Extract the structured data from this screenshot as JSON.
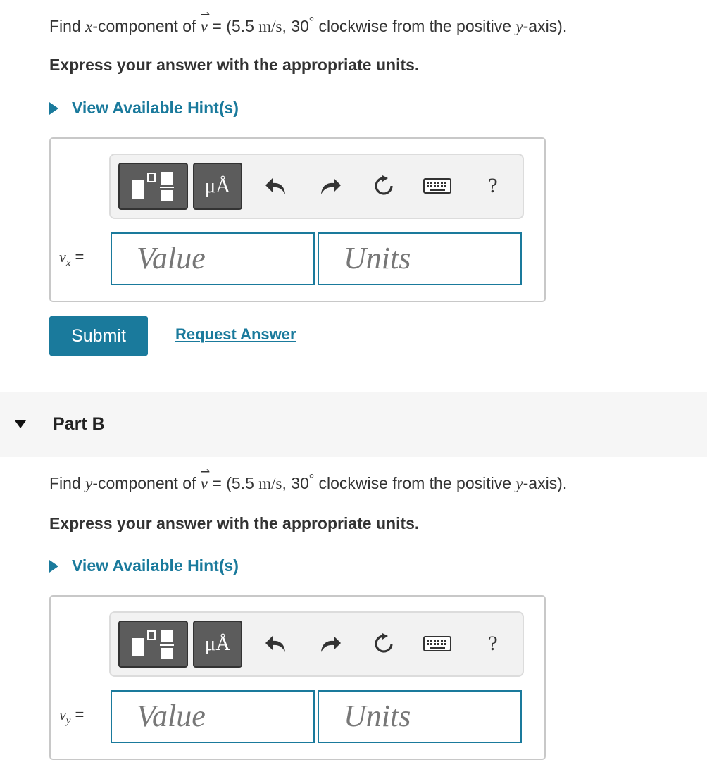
{
  "partA": {
    "question_prefix": "Find ",
    "question_var": "x",
    "question_mid": "-component of ",
    "vec": "v",
    "equals": " = ",
    "open": "(",
    "magnitude": "5.5",
    "unit_m": "m",
    "slash": "/",
    "unit_s": "s",
    "comma": ", ",
    "angle": "30",
    "degree": "°",
    "direction": " clockwise from the positive ",
    "axis_var": "y",
    "axis_suffix": "-axis).",
    "express": "Express your answer with the appropriate units.",
    "hint": "View Available Hint(s)",
    "var_letter": "v",
    "var_sub": "x",
    "var_eq": " =",
    "value_placeholder": "Value",
    "units_placeholder": "Units",
    "toolbar_units_label": "μÅ",
    "toolbar_help": "?",
    "submit": "Submit",
    "request": "Request Answer"
  },
  "partB": {
    "header": "Part B",
    "question_prefix": "Find ",
    "question_var": "y",
    "question_mid": "-component of ",
    "vec": "v",
    "equals": " = ",
    "open": "(",
    "magnitude": "5.5",
    "unit_m": "m",
    "slash": "/",
    "unit_s": "s",
    "comma": ", ",
    "angle": "30",
    "degree": "°",
    "direction": " clockwise from the positive ",
    "axis_var": "y",
    "axis_suffix": "-axis).",
    "express": "Express your answer with the appropriate units.",
    "hint": "View Available Hint(s)",
    "var_letter": "v",
    "var_sub": "y",
    "var_eq": " =",
    "value_placeholder": "Value",
    "units_placeholder": "Units",
    "toolbar_units_label": "μÅ",
    "toolbar_help": "?"
  },
  "icons": {
    "hint_toggle": "triangle-right-icon",
    "part_collapse": "triangle-down-icon",
    "templates": "fraction-template-icon",
    "undo": "undo-icon",
    "redo": "redo-icon",
    "reset": "reset-icon",
    "keyboard": "keyboard-icon"
  },
  "colors": {
    "accent": "#1a7a9c",
    "toolbar_button": "#5c5c5c",
    "text": "#333333",
    "section_bg": "#f6f6f6"
  }
}
